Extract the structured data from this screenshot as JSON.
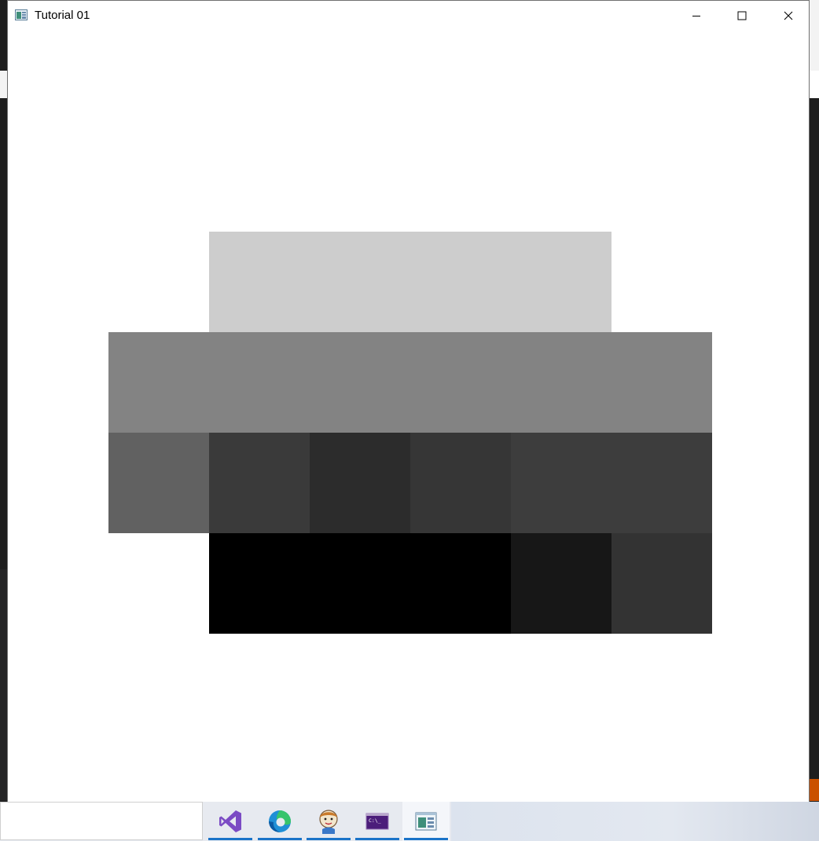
{
  "window": {
    "title": "Tutorial 01",
    "controls": [
      "minimize",
      "maximize",
      "close"
    ]
  },
  "canvas": {
    "tiles": [
      {
        "row": 0,
        "col": 2,
        "color": "#cdcdcd"
      },
      {
        "row": 0,
        "col": 3,
        "color": "#cdcdcd"
      },
      {
        "row": 0,
        "col": 4,
        "color": "#cdcdcd"
      },
      {
        "row": 0,
        "col": 5,
        "color": "#cdcdcd"
      },
      {
        "row": 1,
        "col": 1,
        "color": "#838383"
      },
      {
        "row": 1,
        "col": 2,
        "color": "#838383"
      },
      {
        "row": 1,
        "col": 3,
        "color": "#838383"
      },
      {
        "row": 1,
        "col": 4,
        "color": "#838383"
      },
      {
        "row": 1,
        "col": 5,
        "color": "#838383"
      },
      {
        "row": 1,
        "col": 6,
        "color": "#838383"
      },
      {
        "row": 2,
        "col": 1,
        "color": "#616161"
      },
      {
        "row": 2,
        "col": 2,
        "color": "#3a3a3a"
      },
      {
        "row": 2,
        "col": 3,
        "color": "#2c2c2c"
      },
      {
        "row": 2,
        "col": 4,
        "color": "#363636"
      },
      {
        "row": 2,
        "col": 5,
        "color": "#3d3d3d"
      },
      {
        "row": 2,
        "col": 6,
        "color": "#3d3d3d"
      },
      {
        "row": 3,
        "col": 2,
        "color": "#000000"
      },
      {
        "row": 3,
        "col": 3,
        "color": "#000000"
      },
      {
        "row": 3,
        "col": 4,
        "color": "#000000"
      },
      {
        "row": 3,
        "col": 5,
        "color": "#171717"
      },
      {
        "row": 3,
        "col": 6,
        "color": "#333333"
      }
    ]
  },
  "taskbar": {
    "items": [
      {
        "name": "visual-studio",
        "icon": "visual-studio-icon",
        "active": false
      },
      {
        "name": "edge",
        "icon": "edge-icon",
        "active": false
      },
      {
        "name": "avatar-app",
        "icon": "cartoon-avatar-icon",
        "active": false
      },
      {
        "name": "terminal",
        "icon": "terminal-icon",
        "active": false
      },
      {
        "name": "tutorial-window",
        "icon": "window-app-icon",
        "active": true
      }
    ],
    "terminal_icon_text": "C:\\_"
  },
  "colors": {
    "accent": "#1a73c8",
    "window_bg": "#ffffff"
  }
}
